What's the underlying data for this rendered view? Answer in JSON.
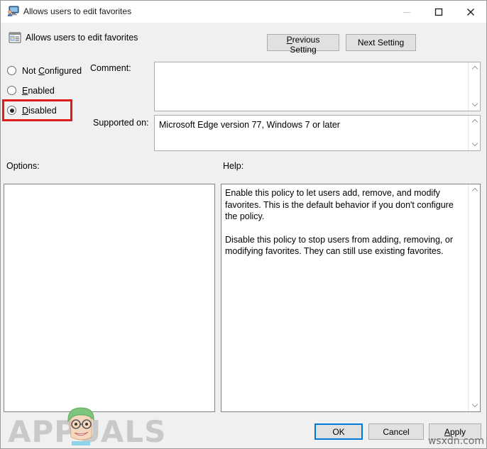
{
  "window": {
    "title": "Allows users to edit favorites",
    "title_icon": "user-policy-monitor-icon",
    "minimize_label": "Minimize",
    "maximize_label": "Maximize",
    "close_label": "Close"
  },
  "header": {
    "setting_name": "Allows users to edit favorites",
    "setting_icon": "policy-setting-icon",
    "previous_setting": "Previous Setting",
    "next_setting": "Next Setting"
  },
  "state_options": [
    {
      "label": "Not Configured",
      "accel_index": 4,
      "selected": false,
      "name": "not-configured"
    },
    {
      "label": "Enabled",
      "accel_index": 0,
      "selected": false,
      "name": "enabled"
    },
    {
      "label": "Disabled",
      "accel_index": 0,
      "selected": true,
      "name": "disabled"
    }
  ],
  "state_labels": {
    "not_configured_pre": "Not ",
    "not_configured_accel": "C",
    "not_configured_post": "onfigured",
    "enabled_accel": "E",
    "enabled_post": "nabled",
    "disabled_accel": "D",
    "disabled_post": "isabled"
  },
  "comment": {
    "label": "Comment:",
    "value": "",
    "placeholder": ""
  },
  "supported_on": {
    "label": "Supported on:",
    "value": "Microsoft Edge version 77, Windows 7 or later"
  },
  "options": {
    "label": "Options:",
    "content": ""
  },
  "help": {
    "label": "Help:",
    "paragraph1": "Enable this policy to let users add, remove, and modify favorites. This is the default behavior if you don't configure the policy.",
    "paragraph2": "Disable this policy to stop users from adding, removing, or modifying favorites. They can still use existing favorites."
  },
  "footer": {
    "ok": "OK",
    "cancel": "Cancel",
    "apply_accel": "A",
    "apply_post": "pply"
  },
  "annotation": {
    "color": "#e01b1b",
    "target": "disabled-radio-option"
  },
  "watermarks": {
    "brand": "APPUALS",
    "site": "wsxdn.com"
  },
  "colors": {
    "window_bg": "#f0f0f0",
    "titlebar_bg": "#ffffff",
    "field_bg": "#ffffff",
    "button_bg": "#e1e1e1",
    "button_border": "#adadad",
    "focus_blue": "#0078d7",
    "annotation_red": "#e01b1b"
  }
}
